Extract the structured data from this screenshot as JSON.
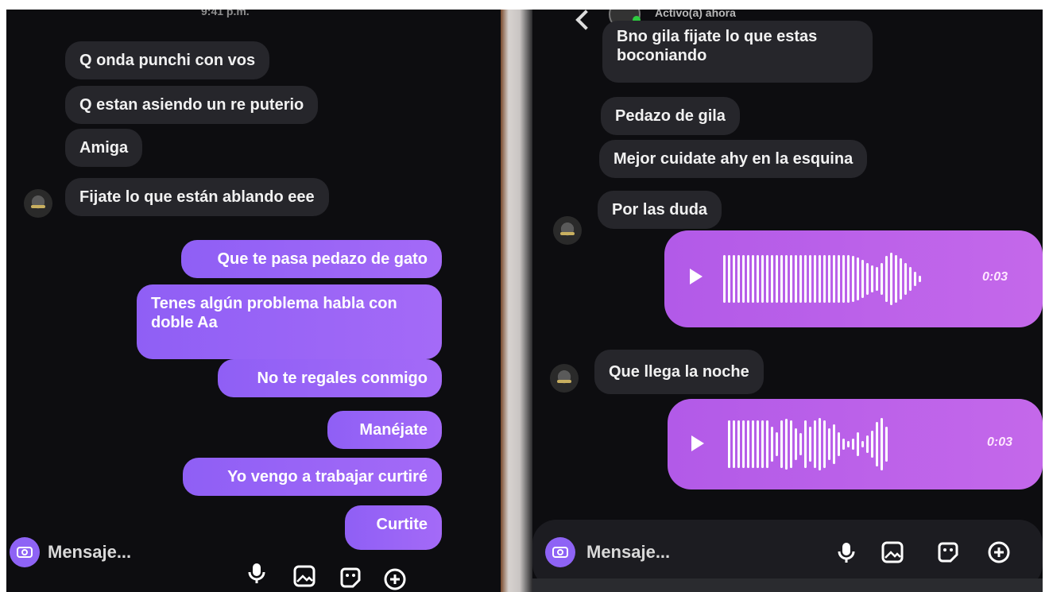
{
  "left": {
    "timestamp": "9:41 p.m.",
    "messages": [
      {
        "text": "Q onda punchi con vos",
        "dir": "received"
      },
      {
        "text": "Q estan asiendo un re puterio",
        "dir": "received"
      },
      {
        "text": "Amiga",
        "dir": "received"
      },
      {
        "text": "Fijate lo que están ablando eee",
        "dir": "received"
      },
      {
        "text": "Que te pasa pedazo de gato",
        "dir": "sent"
      },
      {
        "text": "Tenes algún problema habla con doble Aa",
        "dir": "sent"
      },
      {
        "text": "No te regales conmigo",
        "dir": "sent"
      },
      {
        "text": "Manéjate",
        "dir": "sent"
      },
      {
        "text": "Yo vengo a trabajar curtiré",
        "dir": "sent"
      },
      {
        "text": "Curtite",
        "dir": "sent"
      }
    ],
    "composer": {
      "placeholder": "Mensaje..."
    }
  },
  "right": {
    "header": {
      "status": "Activo(a) ahora"
    },
    "messages": [
      {
        "text": "Bno gila fijate lo que estas boconiando",
        "dir": "received"
      },
      {
        "text": "Pedazo de gila",
        "dir": "received"
      },
      {
        "text": "Mejor cuidate ahy en la esquina",
        "dir": "received"
      },
      {
        "text": "Por las duda",
        "dir": "received"
      },
      {
        "text": "Que llega la noche",
        "dir": "received"
      }
    ],
    "voice_messages": [
      {
        "duration": "0:03"
      },
      {
        "duration": "0:03"
      }
    ],
    "composer": {
      "placeholder": "Mensaje..."
    }
  },
  "colors": {
    "background": "#0d0d10",
    "received_bubble": "#26262b",
    "sent_bubble": "#9a66f6",
    "voice_bubble": "#bb60e9",
    "online": "#2ecc40"
  },
  "icons": [
    "back-arrow-icon",
    "camera-icon",
    "microphone-icon",
    "gallery-icon",
    "sticker-icon",
    "plus-circle-icon"
  ]
}
